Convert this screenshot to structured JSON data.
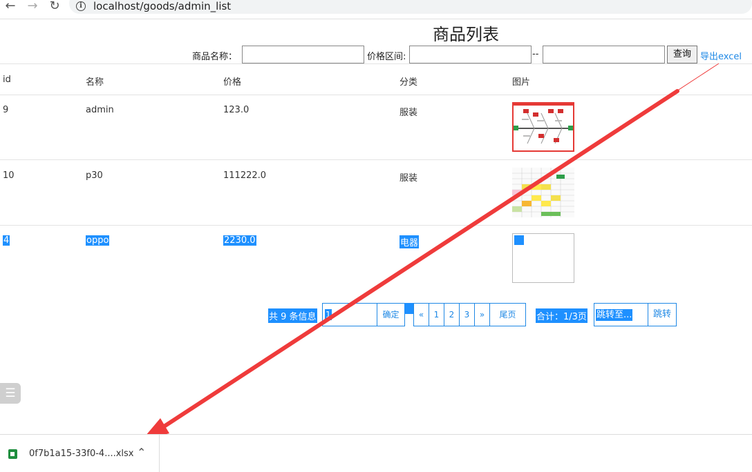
{
  "browser": {
    "url": "localhost/goods/admin_list",
    "back_icon": "←",
    "forward_icon": "→",
    "reload_icon": "↻"
  },
  "page": {
    "title": "商品列表",
    "search": {
      "name_label": "商品名称：",
      "name_value": "",
      "price_label": "价格区间:",
      "price_min": "",
      "separator": "--",
      "price_max": "",
      "query_button": "查询",
      "export_link": "导出excel"
    }
  },
  "table": {
    "headers": [
      "id",
      "名称",
      "价格",
      "分类",
      "图片"
    ],
    "rows": [
      {
        "id": "9",
        "name": "admin",
        "price": "123.0",
        "category": "服装",
        "image": "fishbone-diagram-thumbnail"
      },
      {
        "id": "10",
        "name": "p30",
        "price": "111222.0",
        "category": "服装",
        "image": "spreadsheet-thumbnail"
      },
      {
        "id": "4",
        "name": "oppo",
        "price": "2230.0",
        "category": "电器",
        "image": "broken-image-thumbnail"
      }
    ]
  },
  "pagination": {
    "total": "共 9 条信息",
    "page_input": "1",
    "confirm": "确定",
    "prev": "«",
    "pages": [
      "1",
      "2",
      "3"
    ],
    "next": "»",
    "last": "尾页",
    "summary": "合计：1/3页",
    "jump_placeholder": "跳转至...",
    "jump_button": "跳转"
  },
  "download_bar": {
    "file_name": "0f7b1a15-33f0-4....xlsx"
  },
  "colors": {
    "accent": "#1e88e5",
    "selection": "#1e90ff",
    "annotation_arrow": "#ef3b3b"
  }
}
